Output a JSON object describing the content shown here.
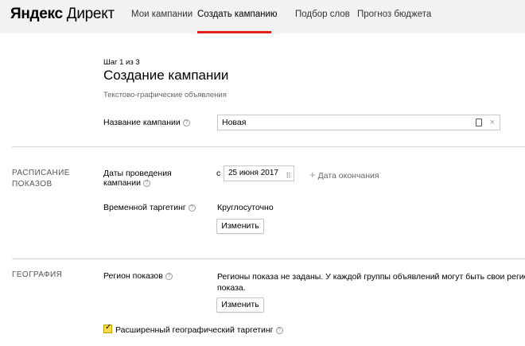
{
  "header": {
    "logo_yandex": "Яндекс",
    "logo_direct": "Директ",
    "nav": {
      "my_campaigns": "Мои кампании",
      "create_campaign": "Создать кампанию",
      "word_selection": "Подбор слов",
      "budget_forecast": "Прогноз бюджета"
    },
    "active_tab": "create_campaign"
  },
  "page": {
    "step": "Шаг 1 из 3",
    "title": "Создание кампании",
    "subtitle": "Текстово-графические объявления"
  },
  "campaign_name": {
    "label": "Название кампании",
    "value": "Новая"
  },
  "schedule": {
    "section_title_line1": "РАСПИСАНИЕ",
    "section_title_line2": "ПОКАЗОВ",
    "dates_label_line1": "Даты проведения",
    "dates_label_line2": "кампании",
    "from_prefix": "с",
    "start_date": "25 июня 2017",
    "add_end_date": "Дата окончания",
    "time_targeting_label": "Временной таргетинг",
    "time_targeting_value": "Круглосуточно",
    "change_button": "Изменить"
  },
  "geography": {
    "section_title": "ГЕОГРАФИЯ",
    "region_label": "Регион показов",
    "region_text_line1": "Регионы показа не заданы. У каждой группы объявлений могут быть свои регионы",
    "region_text_line2": "показа.",
    "change_button": "Изменить",
    "extended_geo_label": "Расширенный географический таргетинг",
    "extended_geo_checked": true
  },
  "colors": {
    "accent_red": "#e0201b",
    "checkbox_yellow": "#ffdb4d",
    "header_bg": "#f2f2f2"
  }
}
